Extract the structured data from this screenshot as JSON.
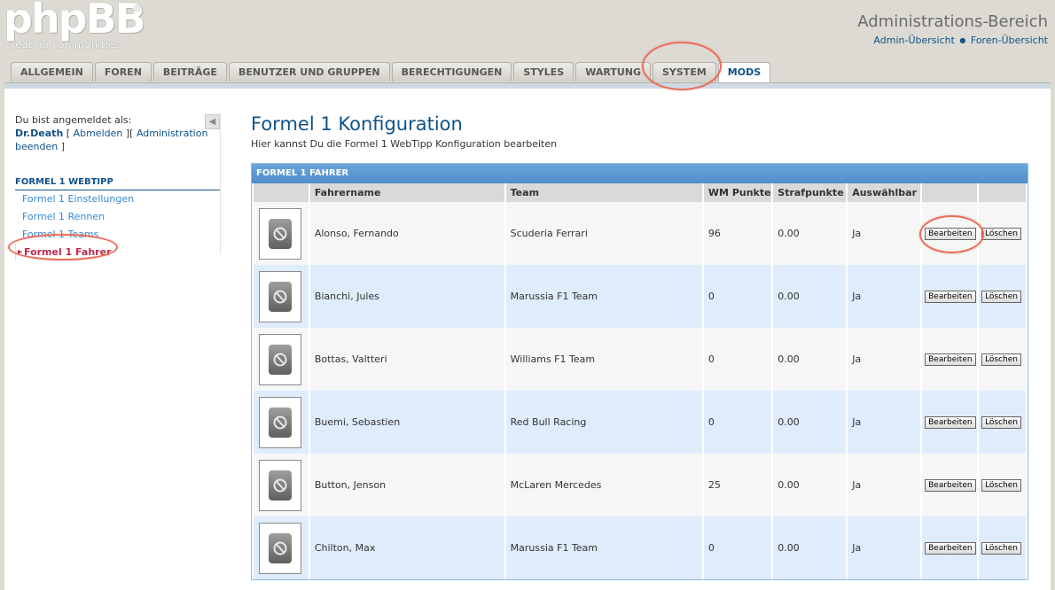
{
  "header": {
    "logo_text": "phpBB",
    "logo_reg": "®",
    "logo_tagline": "creating  communities",
    "admin_title": "Administrations-Bereich",
    "link_admin_overview": "Admin-Übersicht",
    "link_forum_overview": "Foren-Übersicht"
  },
  "tabs": [
    {
      "label": "ALLGEMEIN"
    },
    {
      "label": "FOREN"
    },
    {
      "label": "BEITRÄGE"
    },
    {
      "label": "BENUTZER UND GRUPPEN"
    },
    {
      "label": "BERECHTIGUNGEN"
    },
    {
      "label": "STYLES"
    },
    {
      "label": "WARTUNG"
    },
    {
      "label": "SYSTEM"
    },
    {
      "label": "MODS",
      "active": true
    }
  ],
  "sidebar": {
    "logged_in_label": "Du bist angemeldet als:",
    "username": "Dr.Death",
    "logout": "Abmelden",
    "end_admin": "Administration beenden",
    "section_title": "FORMEL 1 WEBTIPP",
    "items": [
      {
        "label": "Formel 1 Einstellungen"
      },
      {
        "label": "Formel 1 Rennen"
      },
      {
        "label": "Formel 1 Teams"
      },
      {
        "label": "Formel 1 Fahrer",
        "active": true
      }
    ]
  },
  "content": {
    "title": "Formel 1 Konfiguration",
    "description": "Hier kannst Du die Formel 1 WebTipp Konfiguration bearbeiten",
    "table_caption": "FORMEL 1 FAHRER",
    "columns": [
      "",
      "Fahrername",
      "Team",
      "WM Punkte",
      "Strafpunkte",
      "Auswählbar",
      "",
      ""
    ],
    "edit_label": "Bearbeiten",
    "delete_label": "Löschen",
    "rows": [
      {
        "name": "Alonso, Fernando",
        "team": "Scuderia Ferrari",
        "points": "96",
        "penalty": "0.00",
        "selectable": "Ja"
      },
      {
        "name": "Bianchi, Jules",
        "team": "Marussia F1 Team",
        "points": "0",
        "penalty": "0.00",
        "selectable": "Ja"
      },
      {
        "name": "Bottas, Valtteri",
        "team": "Williams F1 Team",
        "points": "0",
        "penalty": "0.00",
        "selectable": "Ja"
      },
      {
        "name": "Buemi, Sebastien",
        "team": "Red Bull Racing",
        "points": "0",
        "penalty": "0.00",
        "selectable": "Ja"
      },
      {
        "name": "Button, Jenson",
        "team": "McLaren Mercedes",
        "points": "25",
        "penalty": "0.00",
        "selectable": "Ja"
      },
      {
        "name": "Chilton, Max",
        "team": "Marussia F1 Team",
        "points": "0",
        "penalty": "0.00",
        "selectable": "Ja"
      }
    ]
  },
  "icons": {
    "collapse": "triangle-left-icon",
    "driver_placeholder": "no-image-icon"
  }
}
